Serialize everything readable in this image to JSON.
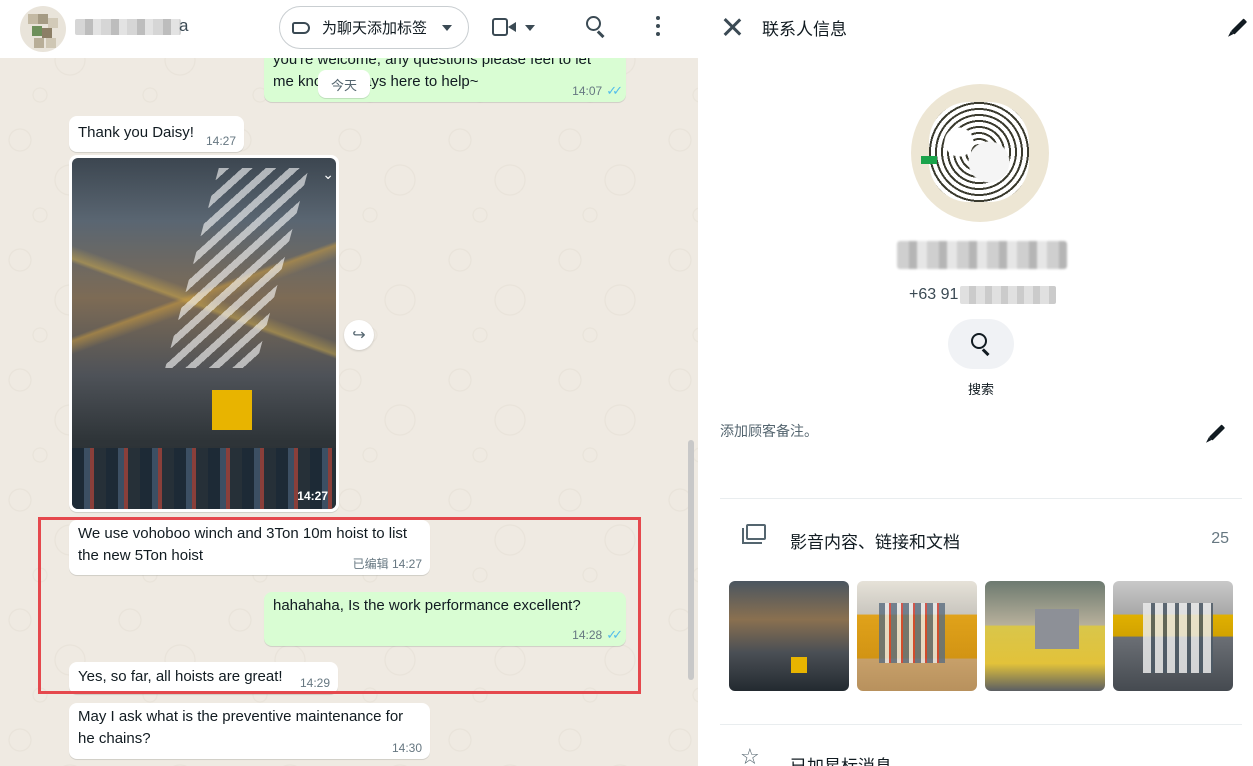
{
  "chat": {
    "contact_name_suffix": "a",
    "label_button": "为聊天添加标签",
    "day_chip": "今天",
    "messages": [
      {
        "text": "you're welcome, any questions please feel to let me know, always here to help~",
        "time": "14:07",
        "edited": ""
      },
      {
        "text": "Thank you Daisy!",
        "time": "14:27",
        "edited": ""
      },
      {
        "text": "",
        "time": "14:27",
        "edited": ""
      },
      {
        "text": "We use vohoboo winch and 3Ton 10m hoist to list the new 5Ton hoist",
        "time": "14:27",
        "edited": "已编辑"
      },
      {
        "text": "hahahaha, Is the work performance excellent?",
        "time": "14:28",
        "edited": ""
      },
      {
        "text": "Yes, so far, all hoists are great!",
        "time": "14:29",
        "edited": ""
      },
      {
        "text": "May I ask what is the preventive maintenance for he chains?",
        "time": "14:30",
        "edited": ""
      }
    ],
    "icons": {
      "label": "label-icon",
      "video": "video-call-icon",
      "search": "search-icon",
      "menu": "more-vertical-icon",
      "forward": "forward-icon"
    }
  },
  "info": {
    "title": "联系人信息",
    "phone_prefix": "+63 91",
    "search_label": "搜索",
    "note_placeholder": "添加顾客备注。",
    "media_title": "影音内容、链接和文档",
    "media_count": "25",
    "starred_title": "已加星标消息"
  },
  "colors": {
    "outgoing_bubble": "#d9fdd3",
    "incoming_bubble": "#ffffff",
    "read_ticks": "#53bdeb",
    "highlight": "#e5484d",
    "chat_background": "#efeae2"
  }
}
